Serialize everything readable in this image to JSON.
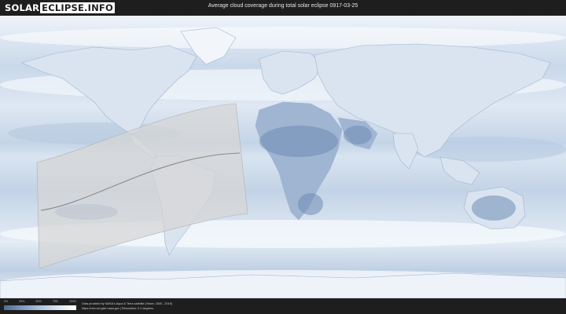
{
  "header": {
    "logo_part1": "SOLAR",
    "logo_part2": "ECLIPSE.INFO",
    "title": "Average cloud coverage during total solar eclipse 0917-03-25"
  },
  "map": {
    "projection": "equirectangular world map",
    "cloud_color_dark": "#4f6c93",
    "cloud_color_light": "#ffffff",
    "eclipse_shadow_fill": "#d6d6d6",
    "central_line_color": "#8a8a8a"
  },
  "legend": {
    "ticks": [
      "0%",
      "25%",
      "50%",
      "75%",
      "100%"
    ]
  },
  "footer": {
    "credit_line_1": "Data provided by NASA's Aqua & Terra satellite (Years: 2000 - 2019)",
    "credit_line_2": "https://neo.sci.gsfc.nasa.gov | Resolution: 0.1 degrees"
  }
}
